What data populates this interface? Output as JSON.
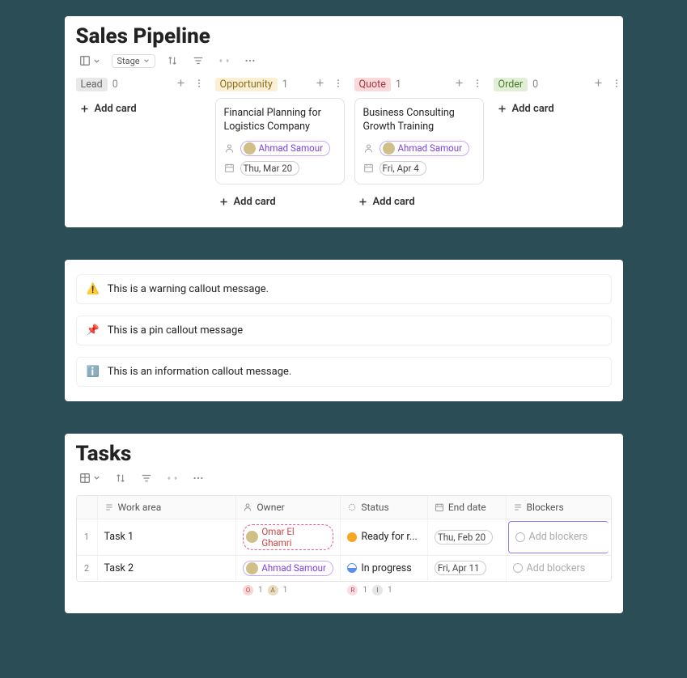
{
  "pipeline": {
    "title": "Sales Pipeline",
    "stage_label": "Stage",
    "add_card_label": "Add card",
    "columns": [
      {
        "label": "Lead",
        "count": "0",
        "bg": "#e8e8e8",
        "fg": "#666",
        "cards": []
      },
      {
        "label": "Opportunity",
        "count": "1",
        "bg": "#fcefd3",
        "fg": "#8a6d1f",
        "cards": [
          {
            "title": "Financial Planning for Logistics Company",
            "person": "Ahmad Samour",
            "date": "Thu, Mar 20"
          }
        ]
      },
      {
        "label": "Quote",
        "count": "1",
        "bg": "#fbd9db",
        "fg": "#a3373f",
        "cards": [
          {
            "title": "Business Consulting Growth Training",
            "person": "Ahmad Samour",
            "date": "Fri, Apr 4"
          }
        ]
      },
      {
        "label": "Order",
        "count": "0",
        "bg": "#e0efd6",
        "fg": "#4a7a2e",
        "cards": []
      }
    ]
  },
  "callouts": [
    {
      "icon": "⚠️",
      "text": "This is a warning callout message."
    },
    {
      "icon": "📌",
      "text": "This is a pin callout message"
    },
    {
      "icon": "ℹ️",
      "text": "This is an information callout message.",
      "icon_color": "#3b82f6"
    }
  ],
  "tasks": {
    "title": "Tasks",
    "headers": {
      "work_area": "Work area",
      "owner": "Owner",
      "status": "Status",
      "end_date": "End date",
      "blockers": "Blockers"
    },
    "blockers_placeholder": "Add blockers",
    "rows": [
      {
        "num": "1",
        "work": "Task 1",
        "owner": "Omar El Ghamri",
        "owner_style": "dashed",
        "status": "Ready for r...",
        "status_type": "ready",
        "date": "Thu, Feb 20",
        "blockers_active": true
      },
      {
        "num": "2",
        "work": "Task 2",
        "owner": "Ahmad Samour",
        "owner_style": "solid",
        "status": "In progress",
        "status_type": "progress",
        "date": "Fri, Apr 11",
        "blockers_active": false
      }
    ],
    "footers": {
      "owner": [
        {
          "letter": "O",
          "bg": "#f6d6d6",
          "fg": "#c44",
          "count": "1"
        },
        {
          "letter": "A",
          "bg": "#e8dcc5",
          "fg": "#8a6d1f",
          "count": "1"
        }
      ],
      "status": [
        {
          "letter": "R",
          "bg": "#fadce3",
          "fg": "#b3446c",
          "count": "1"
        },
        {
          "letter": "I",
          "bg": "#e5e5e5",
          "fg": "#666",
          "count": "1"
        }
      ]
    }
  }
}
